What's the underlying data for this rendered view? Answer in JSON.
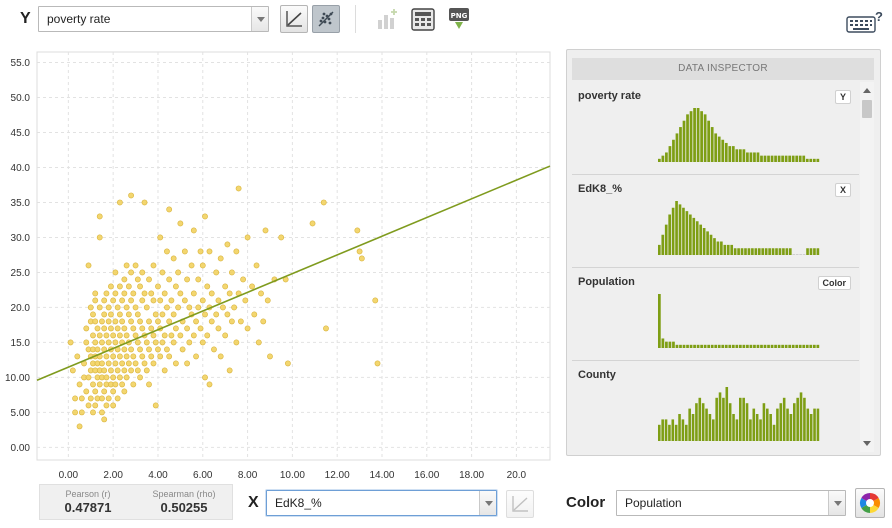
{
  "toolbar": {
    "y_label": "Y",
    "y_field": "poverty rate",
    "help_glyph": "?"
  },
  "bottom": {
    "x_label": "X",
    "x_field": "EdK8_%",
    "color_label": "Color",
    "color_field": "Population",
    "pearson_label": "Pearson (r)",
    "pearson_value": "0.47871",
    "spearman_label": "Spearman (rho)",
    "spearman_value": "0.50255"
  },
  "inspector": {
    "title": "DATA INSPECTOR",
    "items": [
      {
        "name": "poverty rate",
        "badge": "Y",
        "hist": [
          1,
          2,
          3,
          5,
          7,
          9,
          11,
          13,
          15,
          16,
          17,
          17,
          16,
          15,
          13,
          11,
          9,
          8,
          7,
          6,
          5,
          5,
          4,
          4,
          4,
          3,
          3,
          3,
          3,
          2,
          2,
          2,
          2,
          2,
          2,
          2,
          2,
          2,
          2,
          2,
          2,
          2,
          1,
          1,
          1,
          1
        ]
      },
      {
        "name": "EdK8_%",
        "badge": "X",
        "hist": [
          3,
          6,
          9,
          12,
          14,
          16,
          15,
          14,
          13,
          12,
          11,
          10,
          9,
          8,
          7,
          6,
          5,
          4,
          4,
          3,
          3,
          3,
          2,
          2,
          2,
          2,
          2,
          2,
          2,
          2,
          2,
          2,
          2,
          2,
          2,
          2,
          2,
          2,
          2,
          0,
          0,
          0,
          0,
          2,
          2,
          2,
          2
        ]
      },
      {
        "name": "Population",
        "badge": "Color",
        "hist": [
          17,
          3,
          2,
          2,
          2,
          1,
          1,
          1,
          1,
          1,
          1,
          1,
          1,
          1,
          1,
          1,
          1,
          1,
          1,
          1,
          1,
          1,
          1,
          1,
          1,
          1,
          1,
          1,
          1,
          1,
          1,
          1,
          1,
          1,
          1,
          1,
          1,
          1,
          1,
          1,
          1,
          1,
          1,
          1,
          1,
          1
        ]
      },
      {
        "name": "County",
        "badge": "",
        "hist": [
          3,
          4,
          4,
          3,
          4,
          3,
          5,
          4,
          3,
          6,
          5,
          7,
          8,
          7,
          6,
          5,
          4,
          8,
          9,
          8,
          10,
          7,
          5,
          4,
          8,
          8,
          7,
          4,
          6,
          5,
          4,
          7,
          6,
          5,
          3,
          6,
          7,
          8,
          6,
          5,
          7,
          8,
          9,
          8,
          6,
          5,
          6,
          6
        ]
      }
    ]
  },
  "chart_data": {
    "type": "scatter",
    "x_ticks": [
      "0.00",
      "2.00",
      "4.00",
      "6.00",
      "8.00",
      "10.00",
      "12.00",
      "14.00",
      "16.00",
      "18.00",
      "20.0"
    ],
    "y_ticks": [
      "0.00",
      "5.00",
      "10.00",
      "15.0",
      "20.0",
      "25.0",
      "30.0",
      "35.0",
      "40.0",
      "45.0",
      "50.0",
      "55.0"
    ],
    "xlim": [
      -1.4,
      21.5
    ],
    "ylim": [
      -1.8,
      56.5
    ],
    "grid": true,
    "regression_line": {
      "x1": -1.4,
      "y1": 9.6,
      "x2": 21.5,
      "y2": 40.2
    },
    "points": [
      [
        0.1,
        15
      ],
      [
        0.2,
        11
      ],
      [
        0.3,
        7
      ],
      [
        0.3,
        5
      ],
      [
        0.4,
        13
      ],
      [
        0.5,
        9
      ],
      [
        0.5,
        3
      ],
      [
        0.6,
        7
      ],
      [
        0.6,
        5
      ],
      [
        0.7,
        10
      ],
      [
        0.7,
        12
      ],
      [
        0.8,
        17
      ],
      [
        0.8,
        15
      ],
      [
        0.8,
        8
      ],
      [
        0.9,
        26
      ],
      [
        0.9,
        14
      ],
      [
        0.9,
        10
      ],
      [
        0.9,
        6
      ],
      [
        1.0,
        20
      ],
      [
        1.0,
        18
      ],
      [
        1.0,
        13
      ],
      [
        1.0,
        11
      ],
      [
        1.0,
        7
      ],
      [
        1.1,
        19
      ],
      [
        1.1,
        16
      ],
      [
        1.1,
        14
      ],
      [
        1.1,
        12
      ],
      [
        1.1,
        9
      ],
      [
        1.1,
        5
      ],
      [
        1.2,
        22
      ],
      [
        1.2,
        21
      ],
      [
        1.2,
        18
      ],
      [
        1.2,
        15
      ],
      [
        1.2,
        13
      ],
      [
        1.2,
        11
      ],
      [
        1.2,
        8
      ],
      [
        1.2,
        6
      ],
      [
        1.3,
        17
      ],
      [
        1.3,
        14
      ],
      [
        1.3,
        12
      ],
      [
        1.3,
        10
      ],
      [
        1.3,
        7
      ],
      [
        1.4,
        33
      ],
      [
        1.4,
        30
      ],
      [
        1.4,
        20
      ],
      [
        1.4,
        16
      ],
      [
        1.4,
        13
      ],
      [
        1.4,
        11
      ],
      [
        1.4,
        9
      ],
      [
        1.5,
        18
      ],
      [
        1.5,
        15
      ],
      [
        1.5,
        12
      ],
      [
        1.5,
        10
      ],
      [
        1.5,
        7
      ],
      [
        1.5,
        5
      ],
      [
        1.6,
        21
      ],
      [
        1.6,
        19
      ],
      [
        1.6,
        17
      ],
      [
        1.6,
        14
      ],
      [
        1.6,
        11
      ],
      [
        1.6,
        8
      ],
      [
        1.6,
        4
      ],
      [
        1.7,
        22
      ],
      [
        1.7,
        16
      ],
      [
        1.7,
        13
      ],
      [
        1.7,
        10
      ],
      [
        1.7,
        9
      ],
      [
        1.7,
        6
      ],
      [
        1.8,
        20
      ],
      [
        1.8,
        18
      ],
      [
        1.8,
        15
      ],
      [
        1.8,
        12
      ],
      [
        1.8,
        7
      ],
      [
        1.9,
        23
      ],
      [
        1.9,
        19
      ],
      [
        1.9,
        17
      ],
      [
        1.9,
        14
      ],
      [
        1.9,
        11
      ],
      [
        1.9,
        9
      ],
      [
        2.0,
        21
      ],
      [
        2.0,
        16
      ],
      [
        2.0,
        13
      ],
      [
        2.0,
        10
      ],
      [
        2.0,
        8
      ],
      [
        2.0,
        6
      ],
      [
        2.1,
        25
      ],
      [
        2.1,
        22
      ],
      [
        2.1,
        18
      ],
      [
        2.1,
        15
      ],
      [
        2.1,
        12
      ],
      [
        2.1,
        9
      ],
      [
        2.2,
        20
      ],
      [
        2.2,
        17
      ],
      [
        2.2,
        14
      ],
      [
        2.2,
        11
      ],
      [
        2.2,
        7
      ],
      [
        2.3,
        35
      ],
      [
        2.3,
        23
      ],
      [
        2.3,
        19
      ],
      [
        2.3,
        16
      ],
      [
        2.3,
        13
      ],
      [
        2.3,
        10
      ],
      [
        2.4,
        21
      ],
      [
        2.4,
        18
      ],
      [
        2.4,
        15
      ],
      [
        2.4,
        12
      ],
      [
        2.4,
        9
      ],
      [
        2.5,
        24
      ],
      [
        2.5,
        22
      ],
      [
        2.5,
        17
      ],
      [
        2.5,
        14
      ],
      [
        2.5,
        11
      ],
      [
        2.5,
        8
      ],
      [
        2.6,
        26
      ],
      [
        2.6,
        20
      ],
      [
        2.6,
        16
      ],
      [
        2.6,
        13
      ],
      [
        2.6,
        10
      ],
      [
        2.7,
        23
      ],
      [
        2.7,
        19
      ],
      [
        2.7,
        15
      ],
      [
        2.7,
        12
      ],
      [
        2.8,
        36
      ],
      [
        2.8,
        25
      ],
      [
        2.8,
        21
      ],
      [
        2.8,
        18
      ],
      [
        2.8,
        14
      ],
      [
        2.8,
        11
      ],
      [
        2.9,
        22
      ],
      [
        2.9,
        17
      ],
      [
        2.9,
        13
      ],
      [
        2.9,
        9
      ],
      [
        3.0,
        26
      ],
      [
        3.0,
        20
      ],
      [
        3.0,
        16
      ],
      [
        3.0,
        12
      ],
      [
        3.1,
        24
      ],
      [
        3.1,
        19
      ],
      [
        3.1,
        15
      ],
      [
        3.1,
        11
      ],
      [
        3.2,
        23
      ],
      [
        3.2,
        18
      ],
      [
        3.2,
        14
      ],
      [
        3.2,
        10
      ],
      [
        3.3,
        25
      ],
      [
        3.3,
        21
      ],
      [
        3.3,
        17
      ],
      [
        3.3,
        13
      ],
      [
        3.4,
        35
      ],
      [
        3.4,
        22
      ],
      [
        3.4,
        16
      ],
      [
        3.4,
        12
      ],
      [
        3.5,
        20
      ],
      [
        3.5,
        15
      ],
      [
        3.5,
        11
      ],
      [
        3.6,
        24
      ],
      [
        3.6,
        18
      ],
      [
        3.6,
        14
      ],
      [
        3.6,
        9
      ],
      [
        3.7,
        22
      ],
      [
        3.7,
        17
      ],
      [
        3.7,
        13
      ],
      [
        3.8,
        26
      ],
      [
        3.8,
        21
      ],
      [
        3.8,
        16
      ],
      [
        3.8,
        12
      ],
      [
        3.9,
        19
      ],
      [
        3.9,
        15
      ],
      [
        3.9,
        6
      ],
      [
        4.0,
        23
      ],
      [
        4.0,
        18
      ],
      [
        4.0,
        14
      ],
      [
        4.1,
        30
      ],
      [
        4.1,
        21
      ],
      [
        4.1,
        17
      ],
      [
        4.1,
        13
      ],
      [
        4.2,
        25
      ],
      [
        4.2,
        19
      ],
      [
        4.2,
        15
      ],
      [
        4.3,
        22
      ],
      [
        4.3,
        16
      ],
      [
        4.3,
        11
      ],
      [
        4.4,
        28
      ],
      [
        4.4,
        20
      ],
      [
        4.4,
        14
      ],
      [
        4.5,
        34
      ],
      [
        4.5,
        24
      ],
      [
        4.5,
        18
      ],
      [
        4.5,
        13
      ],
      [
        4.6,
        21
      ],
      [
        4.6,
        16
      ],
      [
        4.7,
        27
      ],
      [
        4.7,
        19
      ],
      [
        4.7,
        15
      ],
      [
        4.8,
        23
      ],
      [
        4.8,
        17
      ],
      [
        4.8,
        12
      ],
      [
        4.9,
        25
      ],
      [
        4.9,
        20
      ],
      [
        5.0,
        32
      ],
      [
        5.0,
        22
      ],
      [
        5.0,
        16
      ],
      [
        5.1,
        18
      ],
      [
        5.1,
        14
      ],
      [
        5.2,
        28
      ],
      [
        5.2,
        21
      ],
      [
        5.3,
        24
      ],
      [
        5.3,
        17
      ],
      [
        5.3,
        12
      ],
      [
        5.4,
        20
      ],
      [
        5.4,
        15
      ],
      [
        5.5,
        26
      ],
      [
        5.5,
        19
      ],
      [
        5.6,
        31
      ],
      [
        5.6,
        22
      ],
      [
        5.6,
        16
      ],
      [
        5.7,
        18
      ],
      [
        5.7,
        13
      ],
      [
        5.8,
        24
      ],
      [
        5.8,
        20
      ],
      [
        5.9,
        28
      ],
      [
        5.9,
        17
      ],
      [
        6.0,
        26
      ],
      [
        6.0,
        21
      ],
      [
        6.0,
        15
      ],
      [
        6.1,
        33
      ],
      [
        6.1,
        19
      ],
      [
        6.1,
        10
      ],
      [
        6.2,
        23
      ],
      [
        6.2,
        16
      ],
      [
        6.3,
        28
      ],
      [
        6.3,
        20
      ],
      [
        6.3,
        9
      ],
      [
        6.4,
        22
      ],
      [
        6.4,
        18
      ],
      [
        6.5,
        14
      ],
      [
        6.6,
        25
      ],
      [
        6.6,
        19
      ],
      [
        6.7,
        21
      ],
      [
        6.7,
        17
      ],
      [
        6.8,
        27
      ],
      [
        6.8,
        13
      ],
      [
        6.9,
        20
      ],
      [
        7.0,
        23
      ],
      [
        7.0,
        16
      ],
      [
        7.1,
        29
      ],
      [
        7.1,
        19
      ],
      [
        7.2,
        22
      ],
      [
        7.2,
        11
      ],
      [
        7.3,
        25
      ],
      [
        7.3,
        18
      ],
      [
        7.4,
        20
      ],
      [
        7.5,
        28
      ],
      [
        7.5,
        15
      ],
      [
        7.6,
        37
      ],
      [
        7.6,
        22
      ],
      [
        7.7,
        18
      ],
      [
        7.8,
        24
      ],
      [
        7.9,
        21
      ],
      [
        8.0,
        30
      ],
      [
        8.0,
        17
      ],
      [
        8.2,
        23
      ],
      [
        8.3,
        19
      ],
      [
        8.4,
        26
      ],
      [
        8.5,
        15
      ],
      [
        8.6,
        22
      ],
      [
        8.7,
        18
      ],
      [
        8.8,
        31
      ],
      [
        8.9,
        21
      ],
      [
        9.0,
        13
      ],
      [
        9.2,
        24
      ],
      [
        9.5,
        30
      ],
      [
        9.7,
        24
      ],
      [
        9.8,
        12
      ],
      [
        10.9,
        32
      ],
      [
        11.4,
        35
      ],
      [
        11.5,
        17
      ],
      [
        12.9,
        31
      ],
      [
        13.0,
        28
      ],
      [
        13.1,
        27
      ],
      [
        13.7,
        21
      ],
      [
        13.8,
        12
      ]
    ]
  }
}
